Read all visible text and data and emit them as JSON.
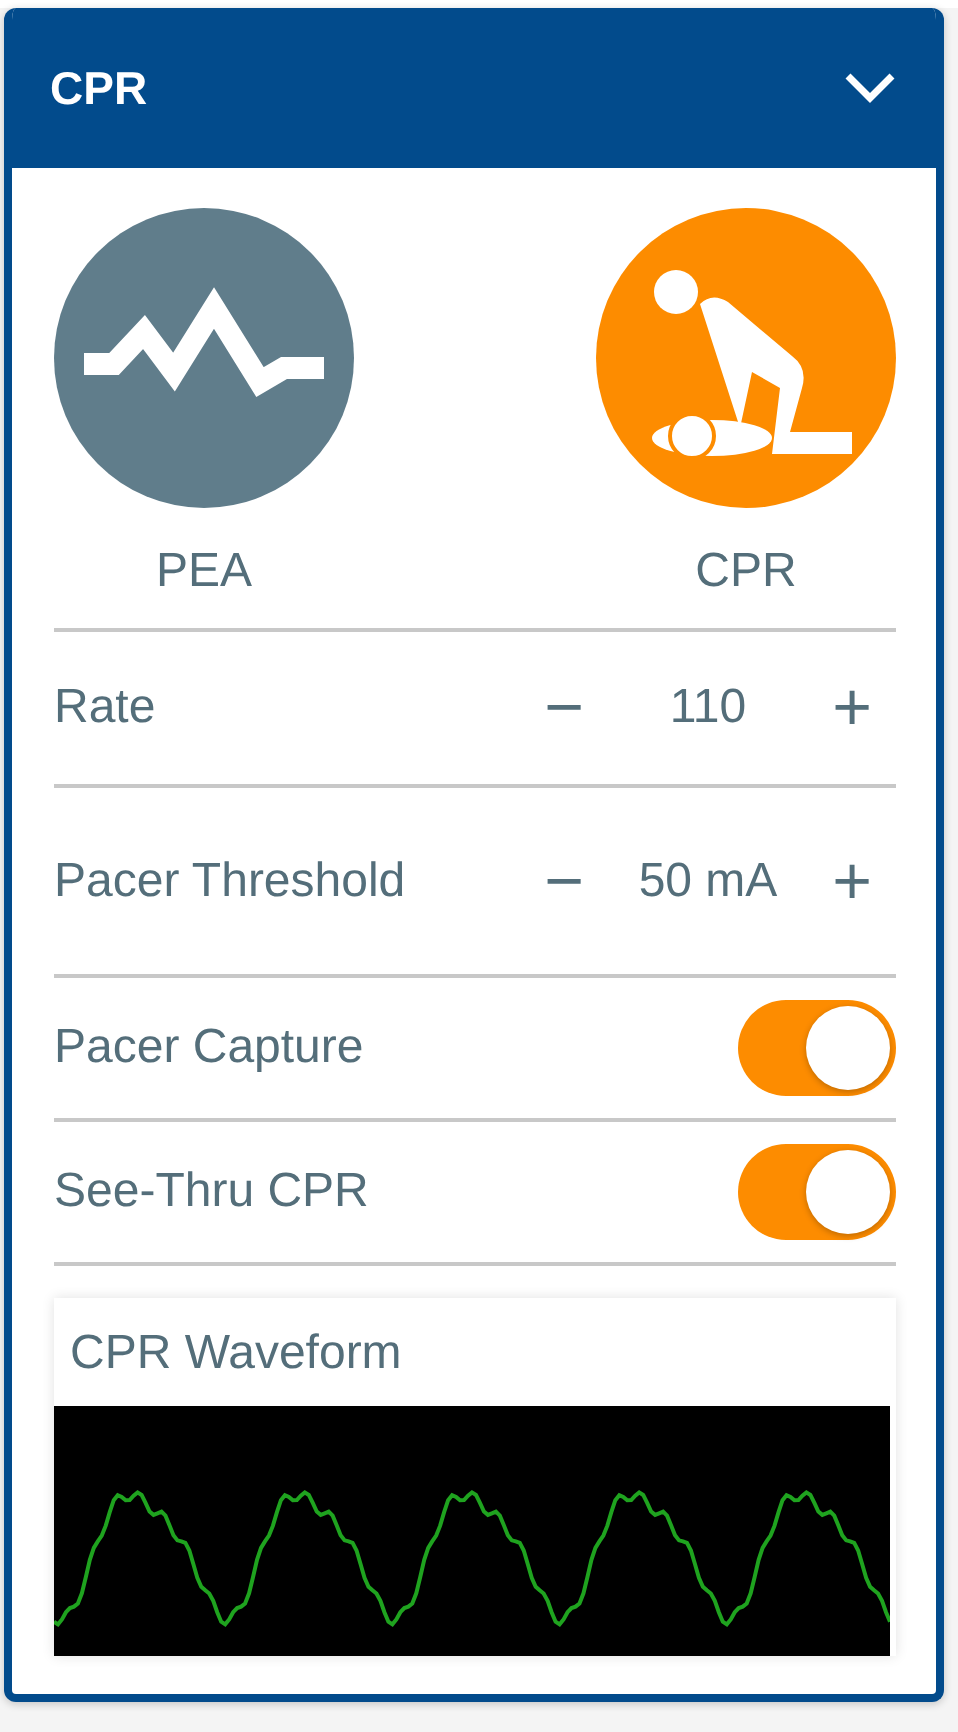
{
  "panel": {
    "title": "CPR",
    "expanded": true
  },
  "modes": [
    {
      "label": "PEA",
      "kind": "pea",
      "selected": false
    },
    {
      "label": "CPR",
      "kind": "cpr",
      "selected": true
    }
  ],
  "settings": [
    {
      "kind": "stepper",
      "label": "Rate",
      "value": "110",
      "minus": "−",
      "plus": "+"
    },
    {
      "kind": "stepper",
      "label": "Pacer Threshold",
      "value": "50 mA",
      "minus": "−",
      "plus": "+"
    },
    {
      "kind": "toggle",
      "label": "Pacer Capture",
      "on": true
    },
    {
      "kind": "toggle",
      "label": "See-Thru CPR",
      "on": true
    }
  ],
  "waveform": {
    "title": "CPR Waveform"
  }
}
